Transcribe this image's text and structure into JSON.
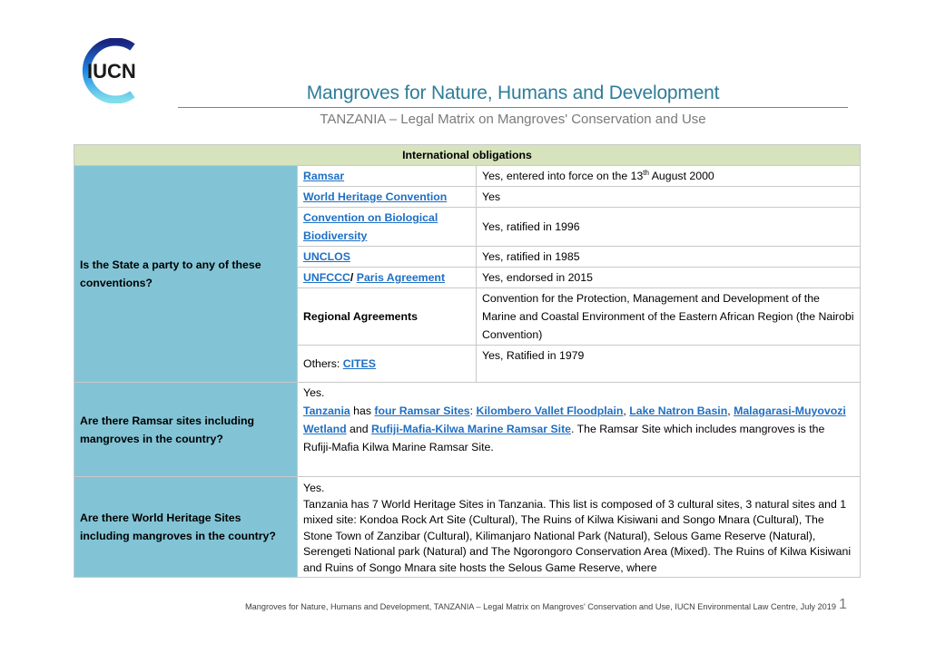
{
  "logo": {
    "text": "IUCN",
    "colors": {
      "ring_start": "#1a237e",
      "ring_end": "#4fc3f7",
      "text": "#1a1a1a"
    }
  },
  "header": {
    "title": "Mangroves for Nature, Humans and Development",
    "subtitle": "TANZANIA – Legal Matrix on Mangroves' Conservation and Use"
  },
  "table": {
    "section_header": "International obligations",
    "q1": {
      "question": "Is the State a party to any of these conventions?",
      "rows": [
        {
          "label": "Ramsar",
          "value_pre": "Yes, entered into force on the 13",
          "value_sup": "th",
          "value_post": " August 2000"
        },
        {
          "label": "World Heritage Convention",
          "value": "Yes"
        },
        {
          "label": "Convention on Biological Biodiversity",
          "value": "Yes, ratified in 1996"
        },
        {
          "label": "UNCLOS",
          "value": "Yes, ratified in 1985"
        },
        {
          "label_a": "UNFCCC",
          "label_sep": "/ ",
          "label_b": "Paris Agreement",
          "value": "Yes, endorsed in 2015"
        },
        {
          "label": "Regional Agreements",
          "value": "Convention for the Protection, Management and Development of the Marine and Coastal Environment of the Eastern African Region (the Nairobi Convention)"
        },
        {
          "label_pre": "Others: ",
          "label_link": "CITES",
          "value": "Yes, Ratified in 1979"
        }
      ]
    },
    "q2": {
      "question": "Are there Ramsar sites including mangroves in the country?",
      "answer": {
        "yes": "Yes.",
        "link_tanzania": "Tanzania",
        "t_has": " has ",
        "link_four": "four Ramsar Sites",
        "t_colon": ": ",
        "link_kilombero": "Kilombero Vallet Floodplain",
        "t_comma1": ", ",
        "link_natron": "Lake Natron Basin",
        "t_comma2": ", ",
        "link_malagarasi": "Malagarasi-Muyovozi Wetland",
        "t_and": " and ",
        "link_rufiji": "Rufiji-Mafia-Kilwa Marine Ramsar Site",
        "t_rest": ". The Ramsar Site which includes mangroves is the Rufiji-Mafia Kilwa Marine Ramsar Site."
      }
    },
    "q3": {
      "question": "Are there World Heritage Sites including mangroves in the country?",
      "answer_yes": "Yes.",
      "answer_text": "Tanzania has 7 World Heritage Sites in Tanzania. This list is composed of 3 cultural sites, 3 natural sites and 1 mixed site: Kondoa Rock Art Site (Cultural), The Ruins of Kilwa Kisiwani and Songo Mnara (Cultural), The Stone Town of Zanzibar (Cultural), Kilimanjaro National Park (Natural), Selous Game Reserve (Natural), Serengeti National park (Natural) and The Ngorongoro Conservation Area (Mixed). The Ruins of Kilwa Kisiwani and Ruins of Songo Mnara site hosts the Selous Game Reserve, where"
    }
  },
  "footer": {
    "text": "Mangroves for Nature, Humans and Development, TANZANIA – Legal Matrix on Mangroves' Conservation and Use, IUCN Environmental Law Centre, July 2019",
    "page_number": "1"
  }
}
